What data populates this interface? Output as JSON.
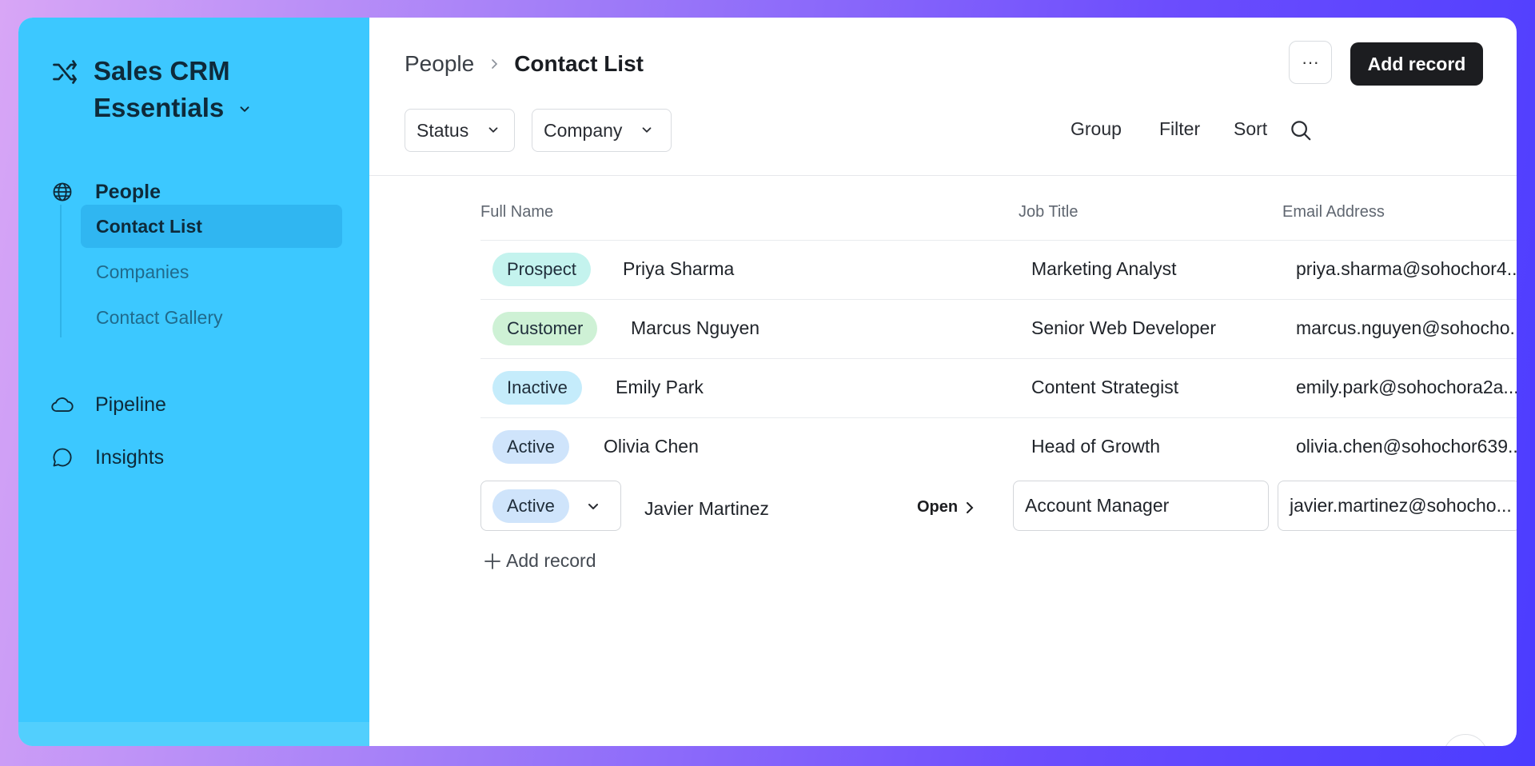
{
  "app": {
    "title": "Sales CRM Essentials"
  },
  "sidebar": {
    "sections": [
      {
        "label": "People",
        "icon": "globe-icon"
      },
      {
        "label": "Pipeline",
        "icon": "cloud-icon"
      },
      {
        "label": "Insights",
        "icon": "chat-bubble-icon"
      }
    ],
    "people_items": [
      {
        "label": "Contact List",
        "active": true
      },
      {
        "label": "Companies",
        "active": false
      },
      {
        "label": "Contact Gallery",
        "active": false
      }
    ]
  },
  "header": {
    "breadcrumb_parent": "People",
    "breadcrumb_current": "Contact List",
    "more_label": "···",
    "add_record_label": "Add record"
  },
  "filters": {
    "status_label": "Status",
    "company_label": "Company"
  },
  "toolbar": {
    "group_label": "Group",
    "filter_label": "Filter",
    "sort_label": "Sort"
  },
  "table": {
    "columns": [
      "Full Name",
      "Job Title",
      "Email Address"
    ],
    "rows": [
      {
        "status": "Prospect",
        "status_color": "#c4f3ee",
        "name": "Priya Sharma",
        "job": "Marketing Analyst",
        "email": "priya.sharma@sohochor4..."
      },
      {
        "status": "Customer",
        "status_color": "#cef1d5",
        "name": "Marcus Nguyen",
        "job": "Senior Web Developer",
        "email": "marcus.nguyen@sohocho..."
      },
      {
        "status": "Inactive",
        "status_color": "#c5ecfb",
        "name": "Emily Park",
        "job": "Content Strategist",
        "email": "emily.park@sohochora2a..."
      },
      {
        "status": "Active",
        "status_color": "#cfe4fb",
        "name": "Olivia Chen",
        "job": "Head of Growth",
        "email": "olivia.chen@sohochor639..."
      },
      {
        "status": "Active",
        "status_color": "#cfe4fb",
        "name": "Javier Martinez",
        "job": "Account Manager",
        "email": "javier.martinez@sohocho..."
      }
    ],
    "open_label": "Open",
    "add_record_label": "Add record"
  }
}
